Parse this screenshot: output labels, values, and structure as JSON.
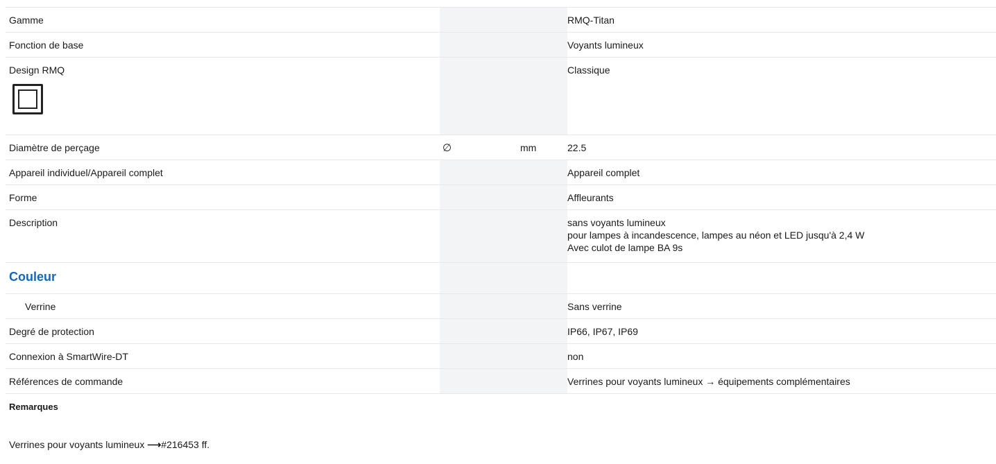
{
  "rows": {
    "gamme": {
      "label": "Gamme",
      "value": "RMQ-Titan"
    },
    "fonction": {
      "label": "Fonction de base",
      "value": "Voyants lumineux"
    },
    "design": {
      "label": "Design RMQ",
      "value": "Classique",
      "icon": "square-frame-icon"
    },
    "diametre": {
      "label": "Diamètre de perçage",
      "symbol": "∅",
      "unit": "mm",
      "value": "22.5"
    },
    "appareil": {
      "label": "Appareil individuel/Appareil complet",
      "value": "Appareil complet"
    },
    "forme": {
      "label": "Forme",
      "value": "Affleurants"
    },
    "description": {
      "label": "Description",
      "lines": [
        "sans voyants lumineux",
        "pour lampes à incandescence, lampes au néon et LED jusqu'à 2,4 W",
        "Avec culot de lampe BA 9s"
      ]
    },
    "couleur": {
      "heading": "Couleur"
    },
    "verrine": {
      "label": "Verrine",
      "value": "Sans verrine"
    },
    "protection": {
      "label": "Degré de protection",
      "value": "IP66, IP67, IP69"
    },
    "smartwire": {
      "label": "Connexion à SmartWire-DT",
      "value": "non"
    },
    "references": {
      "label": "Références de commande",
      "value": "Verrines pour voyants lumineux → équipements complémentaires"
    }
  },
  "remarks": {
    "title": "Remarques",
    "text_prefix": "Verrines pour voyants lumineux ",
    "arrow": "⟶",
    "text_suffix": "#216453 ff."
  },
  "colors": {
    "heading": "#1068c0",
    "shaded_column": "#f3f4f6",
    "row_border": "#e8e8ea"
  }
}
